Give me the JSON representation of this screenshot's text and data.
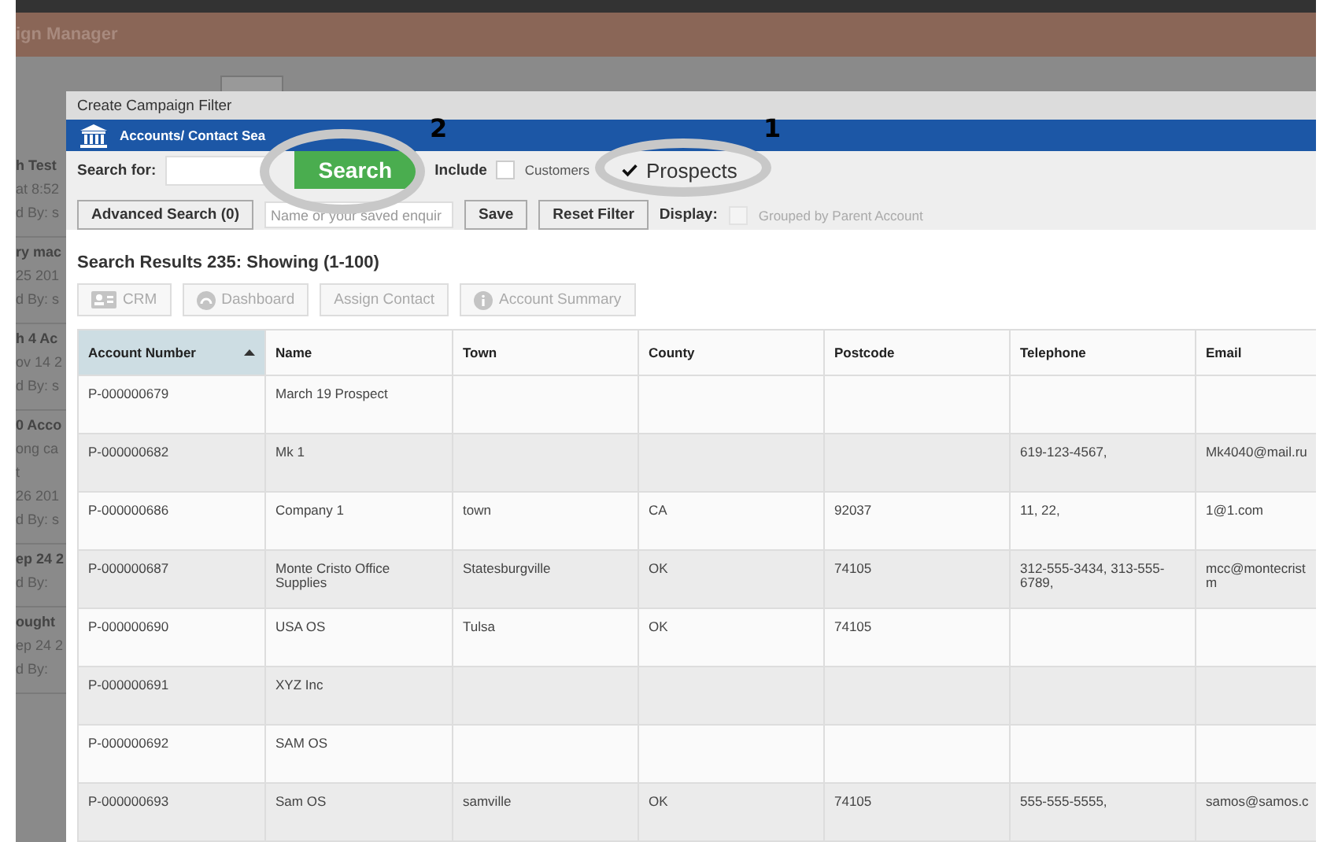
{
  "background_app": {
    "title": "ign Manager",
    "list": [
      {
        "lines": [
          "h Test",
          "at 8:52",
          "d By: s"
        ]
      },
      {
        "lines": [
          "ry mac",
          "25 201",
          "d By: s"
        ]
      },
      {
        "lines": [
          "h 4 Ac",
          "ov 14 2",
          "d By: s"
        ]
      },
      {
        "lines": [
          "0 Acco",
          "ong ca",
          "t",
          "26 201",
          "d By: s"
        ]
      },
      {
        "lines": [
          "ep 24 2",
          "d By:"
        ]
      },
      {
        "lines": [
          "ought",
          "ep 24 2",
          "d By:"
        ]
      }
    ]
  },
  "dialog": {
    "title": "Create Campaign Filter",
    "banner": "Accounts/ Contact Sea",
    "filters": {
      "search_for_label": "Search for:",
      "search_button": "Search",
      "include_label": "Include",
      "include_options": [
        {
          "label": "Customers",
          "checked": false
        },
        {
          "label": "Prospects",
          "checked": true
        }
      ],
      "advanced_search": "Advanced Search (0)",
      "saved_enquiry_placeholder": "Name or your saved enquir",
      "save": "Save",
      "reset": "Reset Filter",
      "display_label": "Display:",
      "grouped": {
        "label": "Grouped by Parent Account",
        "checked": false,
        "disabled": true
      }
    },
    "results_title": "Search Results 235: Showing (1-100)",
    "actions": [
      {
        "label": "CRM",
        "kind": "card",
        "disabled": true
      },
      {
        "label": "Dashboard",
        "kind": "gauge",
        "disabled": true
      },
      {
        "label": "Assign Contact",
        "kind": "plain",
        "disabled": true
      },
      {
        "label": "Account Summary",
        "kind": "info",
        "disabled": true
      }
    ],
    "table": {
      "columns": [
        {
          "label": "Account Number",
          "sorted": true
        },
        {
          "label": "Name",
          "sorted": false
        },
        {
          "label": "Town",
          "sorted": false
        },
        {
          "label": "County",
          "sorted": false
        },
        {
          "label": "Postcode",
          "sorted": false
        },
        {
          "label": "Telephone",
          "sorted": false
        },
        {
          "label": "Email",
          "sorted": false
        }
      ],
      "rows": [
        [
          "P-000000679",
          "March 19 Prospect",
          "",
          "",
          "",
          "",
          ""
        ],
        [
          "P-000000682",
          "Mk 1",
          "",
          "",
          "",
          "619-123-4567,",
          "Mk4040@mail.ru"
        ],
        [
          "P-000000686",
          "Company 1",
          "town",
          "CA",
          "92037",
          "11, 22,",
          "1@1.com"
        ],
        [
          "P-000000687",
          "Monte Cristo Office Supplies",
          "Statesburgville",
          "OK",
          "74105",
          "312-555-3434, 313-555-6789,",
          "mcc@montecrist\nm"
        ],
        [
          "P-000000690",
          "USA OS",
          "Tulsa",
          "OK",
          "74105",
          "",
          ""
        ],
        [
          "P-000000691",
          "XYZ Inc",
          "",
          "",
          "",
          "",
          ""
        ],
        [
          "P-000000692",
          "SAM OS",
          "",
          "",
          "",
          "",
          ""
        ],
        [
          "P-000000693",
          "Sam OS",
          "samville",
          "OK",
          "74105",
          "555-555-5555,",
          "samos@samos.c"
        ]
      ]
    }
  },
  "annotations": [
    {
      "label": "2",
      "kind": "search"
    },
    {
      "label": "1",
      "kind": "prospects"
    }
  ]
}
